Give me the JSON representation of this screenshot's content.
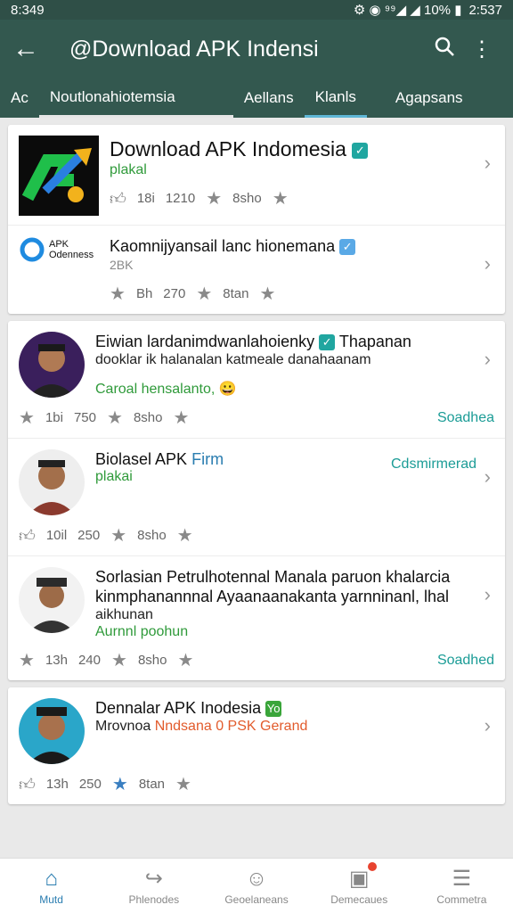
{
  "status": {
    "time_left": "8:349",
    "icons": "⚙ ◉ ⁹⁹◢ ◢ 10% ▮",
    "time_right": "2:537"
  },
  "appbar": {
    "title": "@Download APK Indensi"
  },
  "tabs": [
    "Ac",
    "Noutlonahiotemsia",
    "Aellans",
    "Klanls",
    "Agapsans"
  ],
  "card1": {
    "row1": {
      "name": "Download APK Indomesia",
      "sub": "plakal",
      "like": "18i",
      "count": "1210",
      "count2": "8sho"
    },
    "row2": {
      "logo_text": "APK\nOdenness",
      "name": "Kaomnijyansail lanc hionemana",
      "sub": "2BK",
      "count": "Bh",
      "count2": "270",
      "count3": "8tan"
    }
  },
  "card2": {
    "row1": {
      "name": "Eiwian lardanimdwanlahoienky",
      "name2": "Thapanan",
      "desc": "dooklar ik halanalan katmeale danahaanam",
      "green": "Caroal hensalanto,",
      "like": "1bi",
      "count": "750",
      "count2": "8sho",
      "action": "Soadhea"
    },
    "row2": {
      "name": "Biolasel APK",
      "tag": "Firm",
      "sub": "plakai",
      "action": "Cdsmirmerad",
      "like": "10il",
      "count": "250",
      "count2": "8sho"
    },
    "row3": {
      "name": "Sorlasian Petrulhotennal Manala paruon khalarcia kinmphanannnal Ayaanaanakanta yarnninanl, lhal",
      "sub": "aikhunan",
      "green": "Aurnnl poohun",
      "like": "13h",
      "count": "240",
      "count2": "8sho",
      "action": "Soadhed"
    }
  },
  "card3": {
    "row1": {
      "name": "Dennalar APK Inodesia",
      "tag": "Yo",
      "sub": "Mrovnoa",
      "orange": "Nndsana 0 PSK Gerand",
      "like": "13h",
      "count": "250",
      "count2": "8tan"
    }
  },
  "bottom": [
    "Mutd",
    "Phlenodes",
    "Geoelaneans",
    "Demecaues",
    "Commetra"
  ]
}
